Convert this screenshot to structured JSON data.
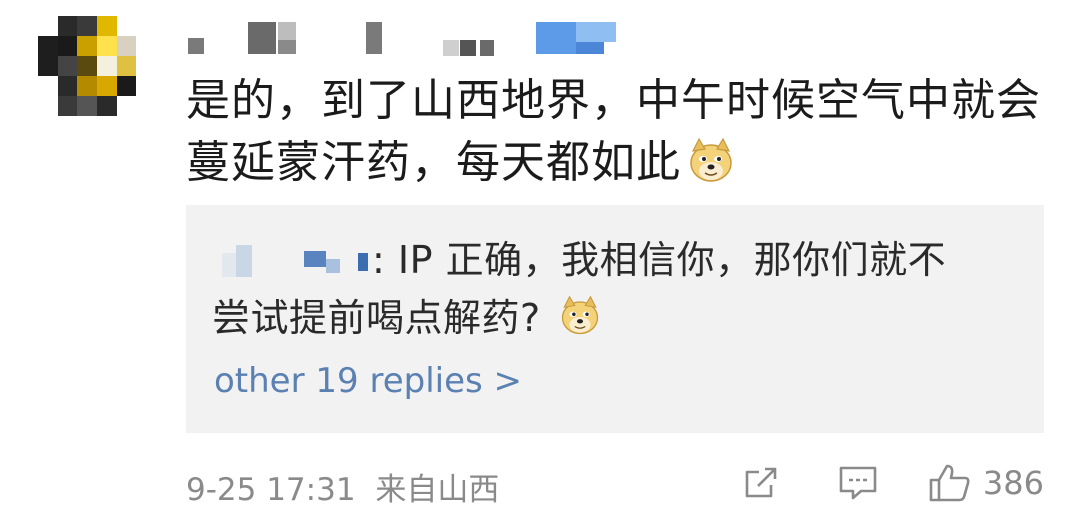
{
  "comment": {
    "line1": "是的，到了山西地界，中午时候空气中就会",
    "line2": "蔓延蒙汗药，每天都如此"
  },
  "reply": {
    "text_line1": ": IP 正确，我相信你，那你们就不",
    "text_line2": "尝试提前喝点解药?",
    "more_label": "other 19 replies >"
  },
  "footer": {
    "time": "9-25 17:31",
    "location": "来自山西",
    "like_count": "386"
  },
  "icons": {
    "share": "share-icon",
    "comment": "comment-icon",
    "like": "thumbs-up-icon",
    "emoji": "doge-emoji-icon"
  },
  "colors": {
    "link": "#5b80b2",
    "meta": "#8a8a8a",
    "reply_bg": "#f2f2f2"
  }
}
